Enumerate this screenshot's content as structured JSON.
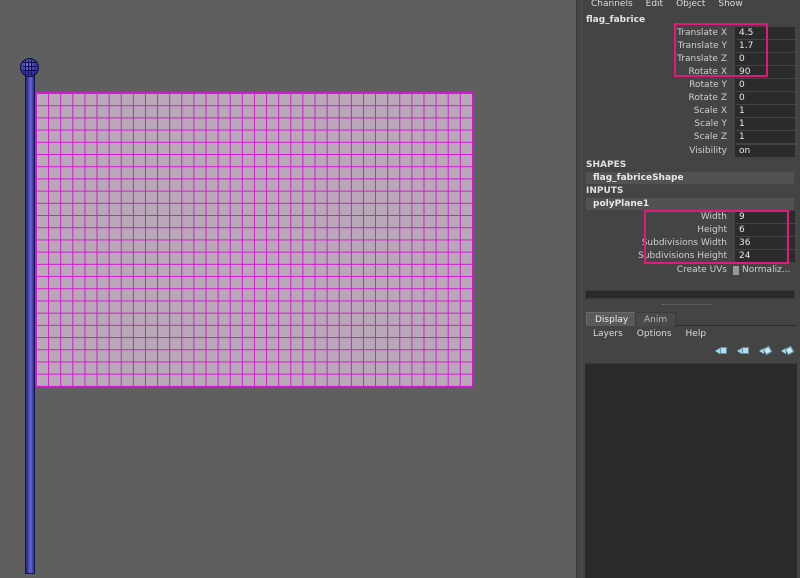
{
  "menubar": {
    "items": [
      "Channels",
      "Edit",
      "Object",
      "Show"
    ]
  },
  "node_name": "flag_fabrice",
  "transform_attrs": [
    {
      "label": "Translate X",
      "value": "4.5"
    },
    {
      "label": "Translate Y",
      "value": "1.7"
    },
    {
      "label": "Translate Z",
      "value": "0"
    },
    {
      "label": "Rotate X",
      "value": "90"
    },
    {
      "label": "Rotate Y",
      "value": "0"
    },
    {
      "label": "Rotate Z",
      "value": "0"
    },
    {
      "label": "Scale X",
      "value": "1"
    },
    {
      "label": "Scale Y",
      "value": "1"
    },
    {
      "label": "Scale Z",
      "value": "1"
    },
    {
      "label": "Visibility",
      "value": "on"
    }
  ],
  "shapes": {
    "header": "SHAPES",
    "node": "flag_fabriceShape"
  },
  "inputs": {
    "header": "INPUTS",
    "node": "polyPlane1",
    "attrs": [
      {
        "label": "Width",
        "value": "9"
      },
      {
        "label": "Height",
        "value": "6"
      },
      {
        "label": "Subdivisions Width",
        "value": "36"
      },
      {
        "label": "Subdivisions Height",
        "value": "24"
      }
    ],
    "create_uvs": {
      "label": "Create UVs",
      "value": "Normaliz..."
    }
  },
  "layer_editor": {
    "tabs": [
      "Display",
      "Anim"
    ],
    "menu": [
      "Layers",
      "Options",
      "Help"
    ],
    "tool_icons": [
      "move-layer-up-icon",
      "move-layer-down-icon",
      "new-layer-icon",
      "new-layer-from-selection-icon"
    ]
  },
  "scene": {
    "flag_grid": {
      "subdivisions_width": 36,
      "subdivisions_height": 24
    },
    "colors": {
      "wireframe": "#d21ad2",
      "flag_fill": "#b9a8b7",
      "pole": "#3b3bb0",
      "highlight": "#e0197b",
      "viewport_bg": "#5f5f5f"
    }
  }
}
